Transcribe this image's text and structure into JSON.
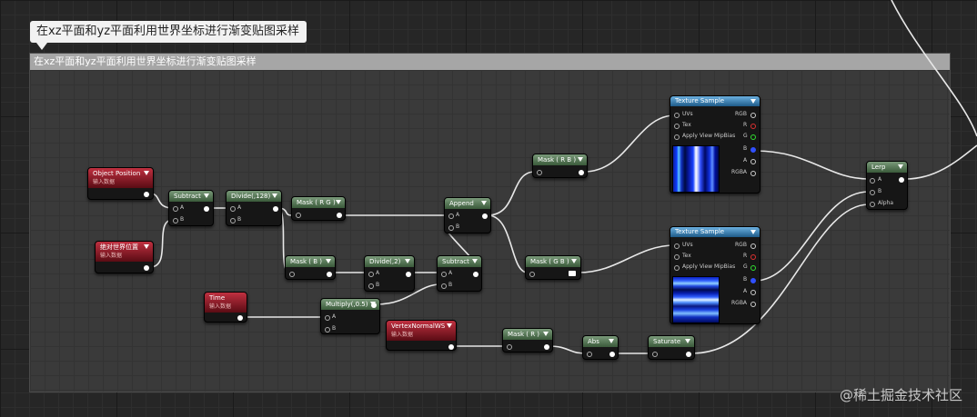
{
  "comment": {
    "bubble_text": "在xz平面和yz平面利用世界坐标进行渐变贴图采样",
    "header_text": "在xz平面和yz平面利用世界坐标进行渐变贴图采样"
  },
  "nodes": {
    "object_position": {
      "title": "Object Position",
      "subtitle": "输入数据"
    },
    "world_position": {
      "title": "绝对世界位置",
      "subtitle": "输入数据"
    },
    "time": {
      "title": "Time",
      "subtitle": "输入数据"
    },
    "vertex_normal": {
      "title": "VertexNormalWS",
      "subtitle": "输入数据"
    },
    "subtract1": {
      "title": "Subtract",
      "pin_a": "A",
      "pin_b": "B"
    },
    "divide128": {
      "title": "Divide(,128)",
      "pin_a": "A",
      "pin_b": "B"
    },
    "mask_rg": {
      "title": "Mask ( R G )"
    },
    "mask_b": {
      "title": "Mask ( B )"
    },
    "divide2": {
      "title": "Divide(,2)",
      "pin_a": "A",
      "pin_b": "B"
    },
    "subtract2": {
      "title": "Subtract",
      "pin_a": "A",
      "pin_b": "B"
    },
    "multiply": {
      "title": "Multiply(,0.5)",
      "pin_a": "A",
      "pin_b": "B"
    },
    "append": {
      "title": "Append",
      "pin_a": "A",
      "pin_b": "B"
    },
    "mask_rb": {
      "title": "Mask ( R B )"
    },
    "mask_gb": {
      "title": "Mask ( G B )"
    },
    "mask_r": {
      "title": "Mask ( R )"
    },
    "abs": {
      "title": "Abs"
    },
    "saturate": {
      "title": "Saturate"
    },
    "tex1": {
      "title": "Texture Sample",
      "inputs": [
        "UVs",
        "Tex",
        "Apply View MipBias"
      ],
      "outputs": [
        "RGB",
        "R",
        "G",
        "B",
        "A",
        "RGBA"
      ]
    },
    "tex2": {
      "title": "Texture Sample",
      "inputs": [
        "UVs",
        "Tex",
        "Apply View MipBias"
      ],
      "outputs": [
        "RGB",
        "R",
        "G",
        "B",
        "A",
        "RGBA"
      ]
    },
    "lerp": {
      "title": "Lerp",
      "pin_a": "A",
      "pin_b": "B",
      "pin_alpha": "Alpha"
    }
  },
  "watermark": "@稀土掘金技术社区",
  "colors": {
    "input_header": "#b02838",
    "function_header": "#5a7a5a",
    "texture_header": "#3a86c0",
    "wire": "#e8e8e8"
  }
}
